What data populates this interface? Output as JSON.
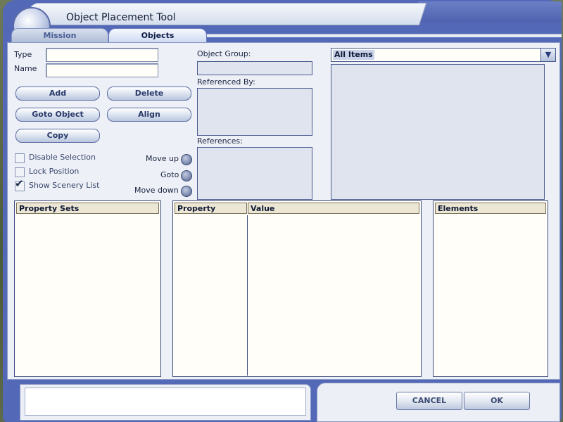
{
  "window": {
    "title": "Object Placement Tool"
  },
  "tabs": [
    {
      "label": "Mission",
      "active": false
    },
    {
      "label": "Objects",
      "active": true
    }
  ],
  "fields": {
    "type_label": "Type",
    "type_value": "",
    "name_label": "Name",
    "name_value": ""
  },
  "buttons": {
    "add": "Add",
    "delete": "Delete",
    "goto_object": "Goto Object",
    "align": "Align",
    "copy": "Copy"
  },
  "checkboxes": [
    {
      "label": "Disable Selection",
      "checked": false
    },
    {
      "label": "Lock Position",
      "checked": false
    },
    {
      "label": "Show Scenery List",
      "checked": true
    }
  ],
  "radios": {
    "move_up": "Move up",
    "goto": "Goto",
    "move_down": "Move down"
  },
  "groups": {
    "object_group_label": "Object Group:",
    "object_group_value": "",
    "referenced_by_label": "Referenced By:",
    "references_label": "References:"
  },
  "dropdown": {
    "selected": "All Items",
    "arrow_icon": "chevron-down-icon"
  },
  "tables": {
    "property_sets_header": "Property Sets",
    "property_header": "Property",
    "value_header": "Value",
    "elements_header": "Elements"
  },
  "footer": {
    "cancel": "CANCEL",
    "ok": "OK"
  },
  "colors": {
    "frame": "#5468b8",
    "panel": "#edf0f6",
    "table_bg": "#fffef8"
  }
}
